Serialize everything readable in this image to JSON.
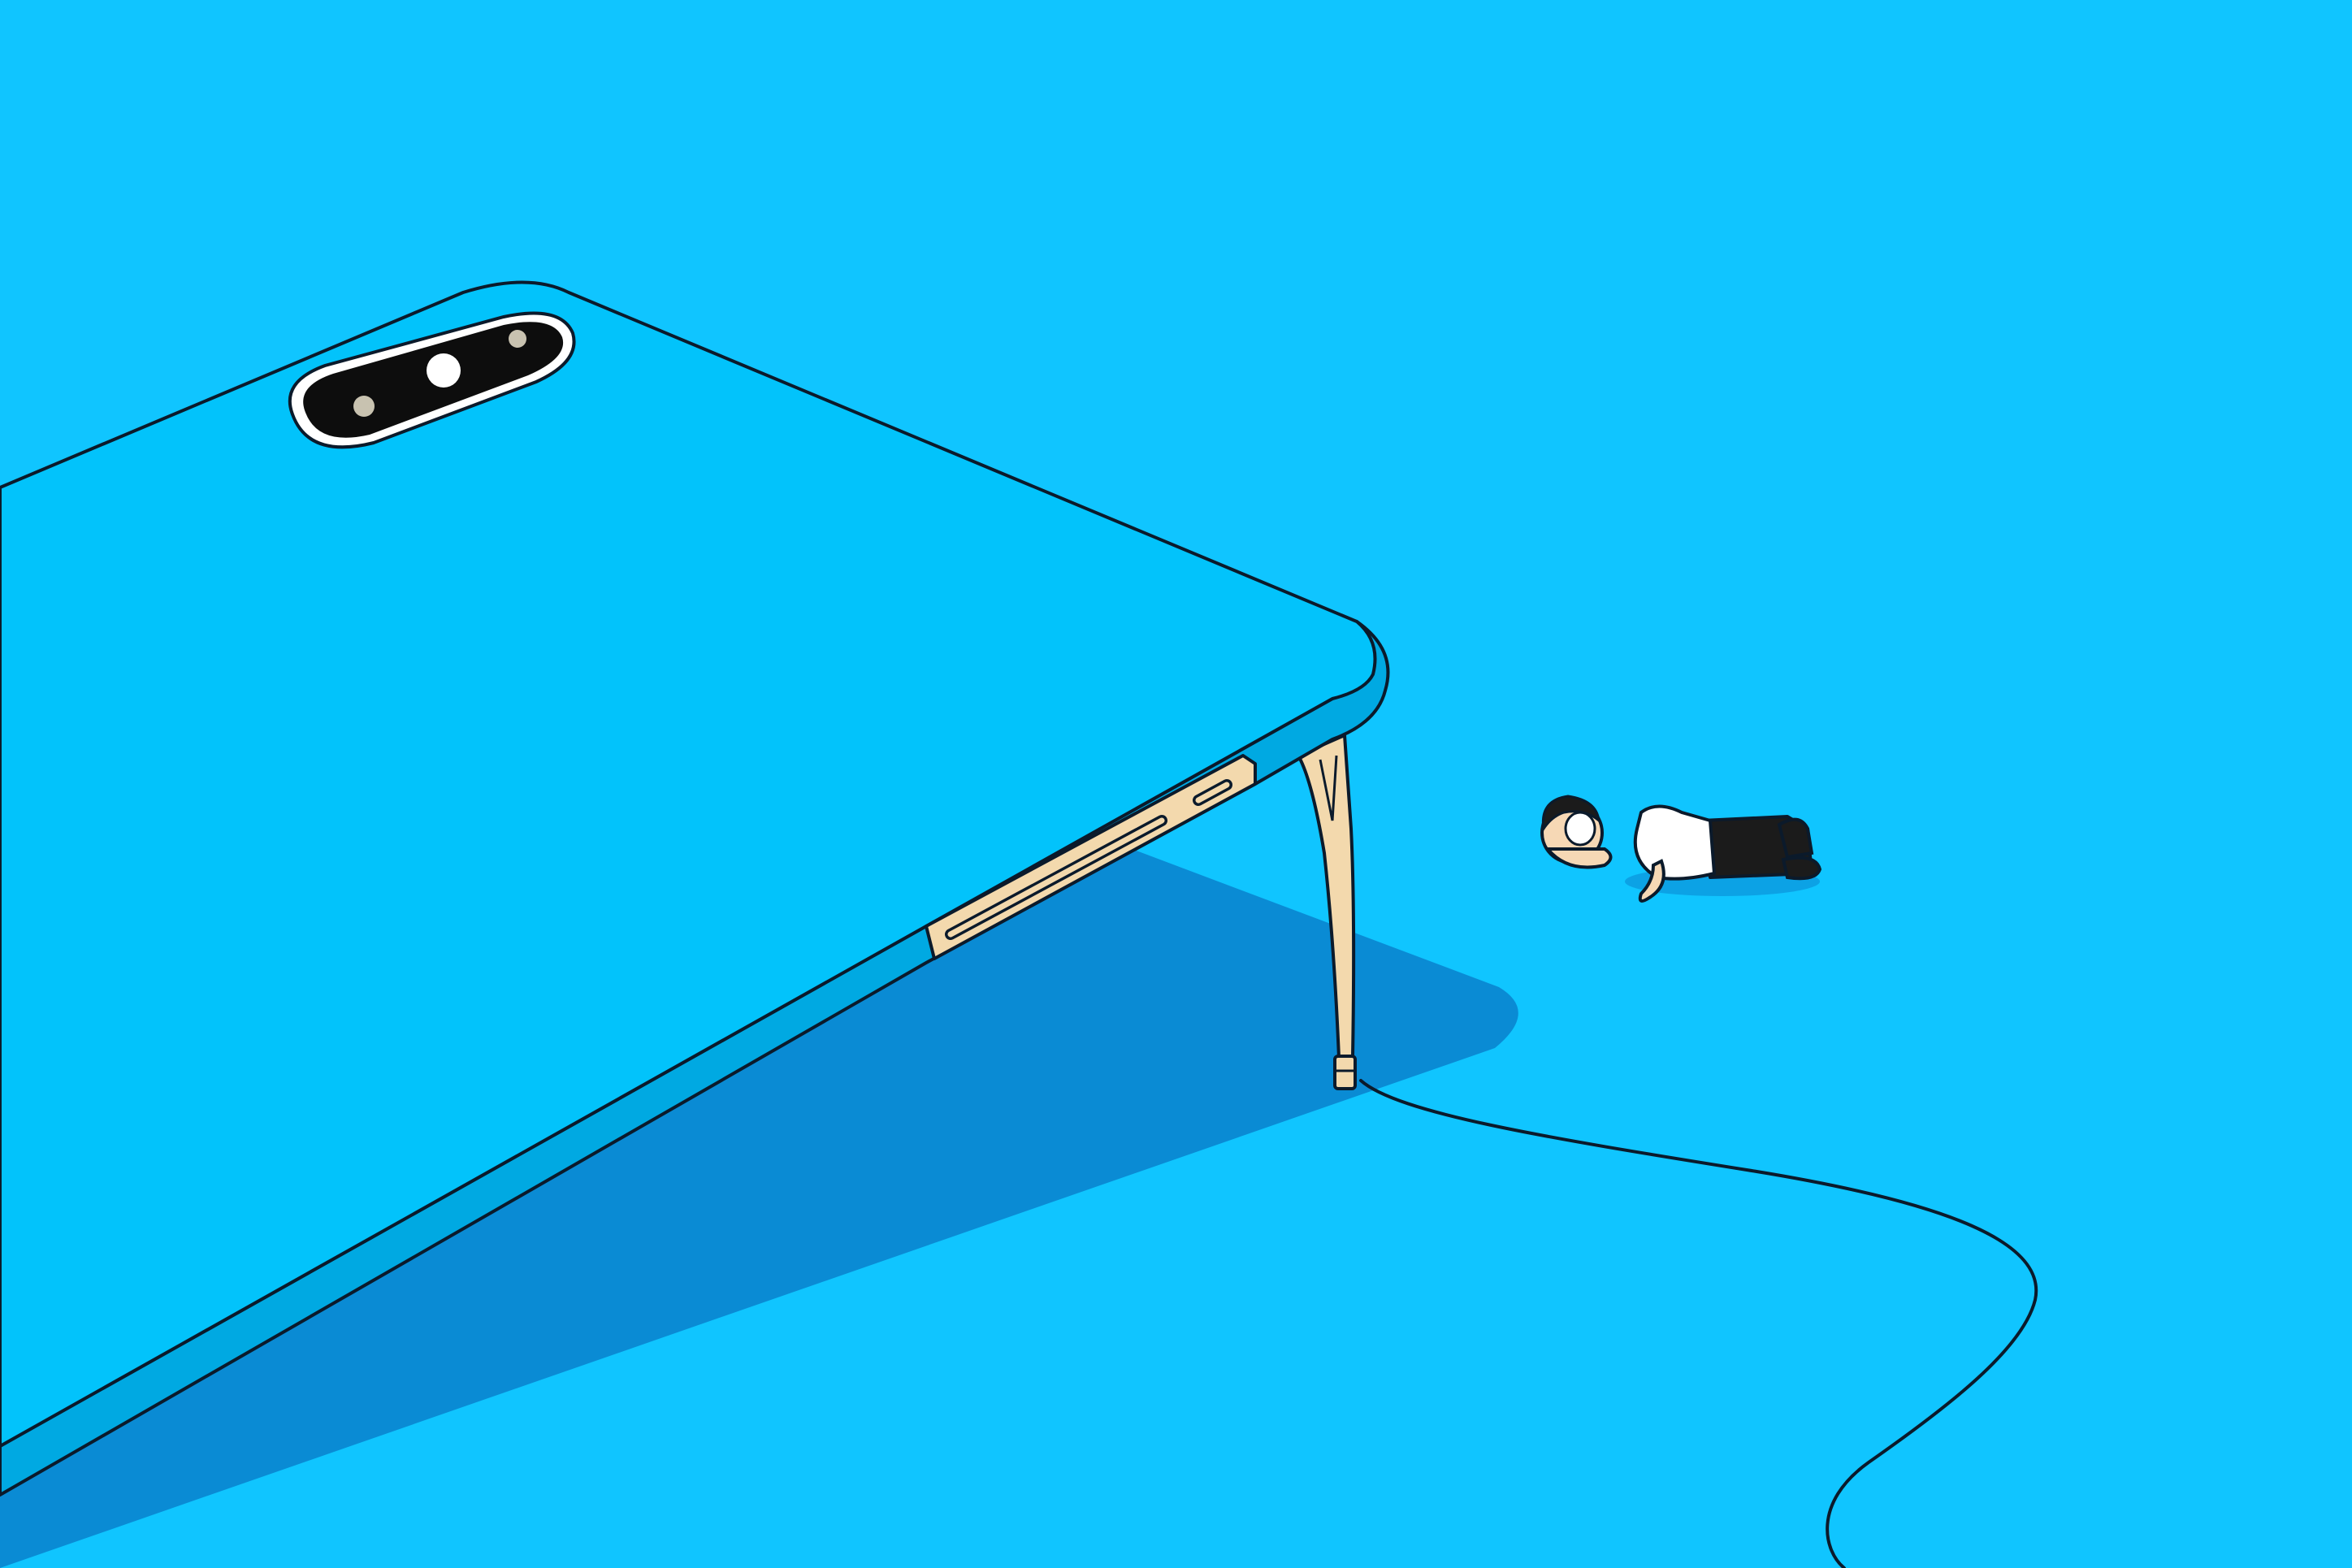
{
  "scene": {
    "colors": {
      "background": "#10c5ff",
      "phone_top": "#02c3fb",
      "phone_edge": "#00a9e2",
      "shadow": "#0a8bd4",
      "outline": "#0b1a2b",
      "stand": "#f3d9ad",
      "camera_lens": "#0d0d0d",
      "person_shirt": "#ffffff",
      "person_pants": "#1b1b1b",
      "person_skin": "#f6d8b5"
    },
    "objects": [
      {
        "name": "smartphone",
        "icon": "phone-icon"
      },
      {
        "name": "camera-module",
        "icon": "camera-icon"
      },
      {
        "name": "kickstand",
        "icon": "stand-icon"
      },
      {
        "name": "charging-cable",
        "icon": "cable-icon"
      },
      {
        "name": "lying-person",
        "icon": "person-icon"
      }
    ]
  }
}
